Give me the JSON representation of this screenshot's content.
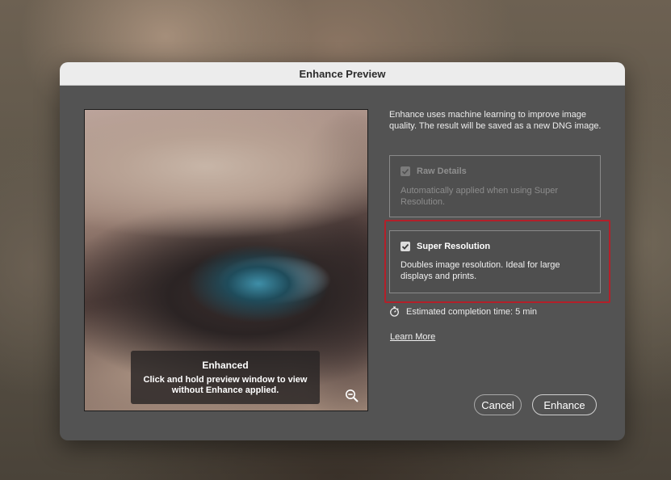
{
  "dialog": {
    "title": "Enhance Preview"
  },
  "preview": {
    "tooltip_title": "Enhanced",
    "tooltip_body": "Click and hold preview window to view without Enhance applied.",
    "zoom_icon": "zoom-out-icon"
  },
  "intro": "Enhance uses machine learning to improve image quality. The result will be saved as a new DNG image.",
  "options": {
    "raw_details": {
      "label": "Raw Details",
      "checked": true,
      "disabled": true,
      "description": "Automatically applied when using Super Resolution."
    },
    "super_resolution": {
      "label": "Super Resolution",
      "checked": true,
      "disabled": false,
      "description": "Doubles image resolution. Ideal for large displays and prints."
    }
  },
  "estimate": {
    "icon": "stopwatch-icon",
    "text": "Estimated completion time: 5 min"
  },
  "learn_more": "Learn More",
  "buttons": {
    "cancel": "Cancel",
    "enhance": "Enhance"
  },
  "colors": {
    "highlight": "#b3202a",
    "dialog_bg": "#535353",
    "titlebar_bg": "#ececec"
  }
}
